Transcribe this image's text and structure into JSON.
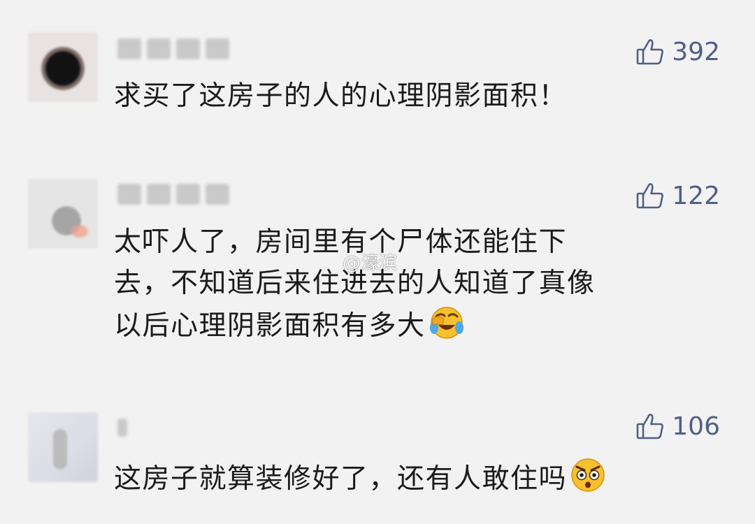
{
  "comments": [
    {
      "likes": "392",
      "text": [
        "求买了这房子的人的心理阴影面积！"
      ]
    },
    {
      "likes": "122",
      "text": [
        "太吓人了，房间里有个尸体还能住下",
        "去，不知道后来住进去的人知道了真像",
        "以后心理阴影面积有多大"
      ],
      "emoji": "crying-laughing-emoji"
    },
    {
      "likes": "106",
      "text": [
        "这房子就算装修好了，还有人敢住吗"
      ],
      "emoji": "shocked-face-emoji"
    }
  ],
  "watermark": "@濠滨",
  "colors": {
    "background": "#f2f2f2",
    "like_color": "#4f5f86",
    "text_color": "#1b1b1b"
  },
  "icons": {
    "like": "thumbs-up-icon"
  }
}
